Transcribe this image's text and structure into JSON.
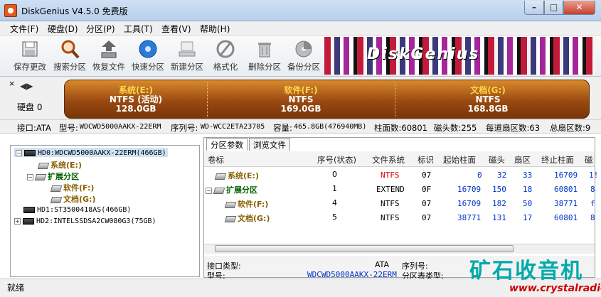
{
  "window": {
    "title": "DiskGenius V4.5.0 免费版",
    "min": "–",
    "max": "□",
    "close": "✕"
  },
  "menu": [
    "文件(F)",
    "硬盘(D)",
    "分区(P)",
    "工具(T)",
    "查看(V)",
    "帮助(H)"
  ],
  "toolbar": [
    {
      "label": "保存更改",
      "icon": "save-icon"
    },
    {
      "label": "搜索分区",
      "icon": "magnifier-icon"
    },
    {
      "label": "恢复文件",
      "icon": "recover-icon"
    },
    {
      "label": "快速分区",
      "icon": "disk-blue-icon"
    },
    {
      "label": "新建分区",
      "icon": "new-partition-icon"
    },
    {
      "label": "格式化",
      "icon": "format-icon"
    },
    {
      "label": "删除分区",
      "icon": "trash-icon"
    },
    {
      "label": "备份分区",
      "icon": "backup-icon"
    }
  ],
  "banner": {
    "text": "DiskGenius"
  },
  "disk": {
    "label": "硬盘 0",
    "close": "×",
    "nav": "◀▶",
    "partitions": [
      {
        "name": "系统(E:)",
        "fs": "NTFS (活动)",
        "size": "128.0GB"
      },
      {
        "name": "软件(F:)",
        "fs": "NTFS",
        "size": "169.0GB"
      },
      {
        "name": "文档(G:)",
        "fs": "NTFS",
        "size": "168.8GB"
      }
    ]
  },
  "info": {
    "interface": "接口:ATA",
    "model_label": "型号:",
    "model": "WDCWD5000AAKX-22ERM",
    "serial_label": "序列号:",
    "serial": "WD-WCC2ETA23705",
    "capacity_label": "容量:",
    "capacity": "465.8GB(476940MB)",
    "cylinders": "柱面数:60801",
    "heads": "磁头数:255",
    "sectors": "每道扇区数:63",
    "total": "总扇区数:9"
  },
  "tree": [
    {
      "text": "HD0:WDCWD5000AAKX-22ERM(466GB)",
      "toggle": "−"
    },
    {
      "text": "系统(E:)"
    },
    {
      "text": "扩展分区",
      "toggle": "−"
    },
    {
      "text": "软件(F:)"
    },
    {
      "text": "文档(G:)"
    },
    {
      "text": "HD1:ST3500418AS(466GB)"
    },
    {
      "text": "HD2:INTELSSDSA2CW080G3(75GB)",
      "toggle": "+"
    }
  ],
  "tabs": [
    "分区参数",
    "浏览文件"
  ],
  "table": {
    "headers": [
      "卷标",
      "序号(状态)",
      "文件系统",
      "标识",
      "起始柱面",
      "磁头",
      "扇区",
      "终止柱面",
      "磁"
    ],
    "rows": [
      {
        "name": "系统(E:)",
        "seq": "0",
        "fs": "NTFS",
        "id": "07",
        "start": "0",
        "head": "32",
        "sector": "33",
        "end": "16709",
        "extra": "1!"
      },
      {
        "name": "扩展分区",
        "seq": "1",
        "fs": "EXTEND",
        "id": "0F",
        "start": "16709",
        "head": "150",
        "sector": "18",
        "end": "60801",
        "extra": "8",
        "toggle": "−"
      },
      {
        "name": "软件(F:)",
        "seq": "4",
        "fs": "NTFS",
        "id": "07",
        "start": "16709",
        "head": "182",
        "sector": "50",
        "end": "38771",
        "extra": "f"
      },
      {
        "name": "文档(G:)",
        "seq": "5",
        "fs": "NTFS",
        "id": "07",
        "start": "38771",
        "head": "131",
        "sector": "17",
        "end": "60801",
        "extra": "8"
      }
    ]
  },
  "bottom": {
    "iface_label": "接口类型:",
    "iface": "ATA",
    "serial_label": "序列号:",
    "model_label": "型号:",
    "model": "WDCWD5000AAKX-22ERM",
    "ptype_label": "分区表类型:"
  },
  "status": "就绪",
  "watermark": {
    "text": "矿石收音机",
    "url": "www.crystalradio.cn"
  }
}
